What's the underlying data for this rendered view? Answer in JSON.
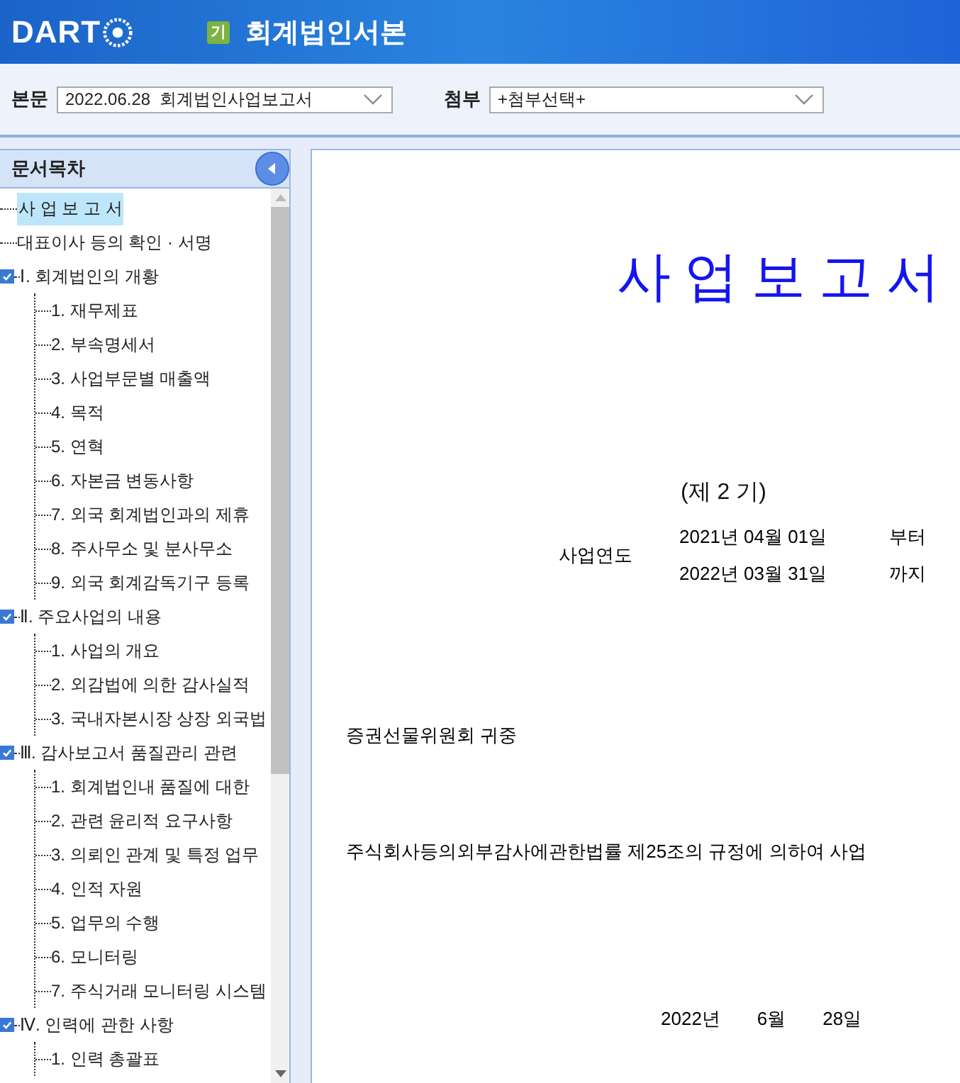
{
  "header": {
    "logo": "DART",
    "badge": "기",
    "title": "회계법인서본"
  },
  "toolbar": {
    "fields": [
      {
        "label": "본문",
        "value": "2022.06.28  회계법인사업보고서"
      },
      {
        "label": "첨부",
        "value": "+첨부선택+"
      }
    ]
  },
  "sidebar": {
    "title": "문서목차",
    "items": [
      {
        "label": "사 업 보 고 서",
        "selected": true
      },
      {
        "label": "대표이사 등의 확인 · 서명",
        "selected": false
      },
      {
        "label": "Ⅰ. 회계법인의 개황",
        "selected": false,
        "expanded": true,
        "children": [
          {
            "label": "1. 재무제표",
            "selected": false
          },
          {
            "label": "2. 부속명세서",
            "selected": false
          },
          {
            "label": "3. 사업부문별 매출액",
            "selected": false
          },
          {
            "label": "4. 목적",
            "selected": false
          },
          {
            "label": "5. 연혁",
            "selected": false
          },
          {
            "label": "6. 자본금 변동사항",
            "selected": false
          },
          {
            "label": "7. 외국 회계법인과의 제휴",
            "selected": false
          },
          {
            "label": "8. 주사무소 및 분사무소",
            "selected": false
          },
          {
            "label": "9. 외국 회계감독기구 등록",
            "selected": false
          }
        ]
      },
      {
        "label": "Ⅱ. 주요사업의 내용",
        "selected": false,
        "expanded": true,
        "children": [
          {
            "label": "1. 사업의 개요",
            "selected": false
          },
          {
            "label": "2. 외감법에 의한 감사실적",
            "selected": false
          },
          {
            "label": "3. 국내자본시장 상장 외국법",
            "selected": false
          }
        ]
      },
      {
        "label": "Ⅲ. 감사보고서 품질관리 관련",
        "selected": false,
        "expanded": true,
        "children": [
          {
            "label": "1. 회계법인내 품질에 대한",
            "selected": false
          },
          {
            "label": "2. 관련 윤리적 요구사항",
            "selected": false
          },
          {
            "label": "3. 의뢰인 관계 및 특정 업무",
            "selected": false
          },
          {
            "label": "4. 인적 자원",
            "selected": false
          },
          {
            "label": "5. 업무의 수행",
            "selected": false
          },
          {
            "label": "6. 모니터링",
            "selected": false
          },
          {
            "label": "7. 주식거래 모니터링 시스템",
            "selected": false
          }
        ]
      },
      {
        "label": "Ⅳ. 인력에 관한 사항",
        "selected": false,
        "expanded": true,
        "children": [
          {
            "label": "1. 인력 총괄표",
            "selected": false
          }
        ]
      }
    ]
  },
  "document": {
    "title": "사 업 보 고 서",
    "period": "(제 2 기)",
    "fiscal_year_label": "사업연도",
    "date_rows": [
      {
        "date": "2021년 04월 01일",
        "suffix": "부터"
      },
      {
        "date": "2022년 03월 31일",
        "suffix": "까지"
      }
    ],
    "addressee": "증권선물위원회 귀중",
    "statement": "주식회사등의외부감사에관한법률 제25조의 규정에 의하여 사업",
    "signed_date": [
      "2022년",
      "6월",
      "28일"
    ]
  }
}
